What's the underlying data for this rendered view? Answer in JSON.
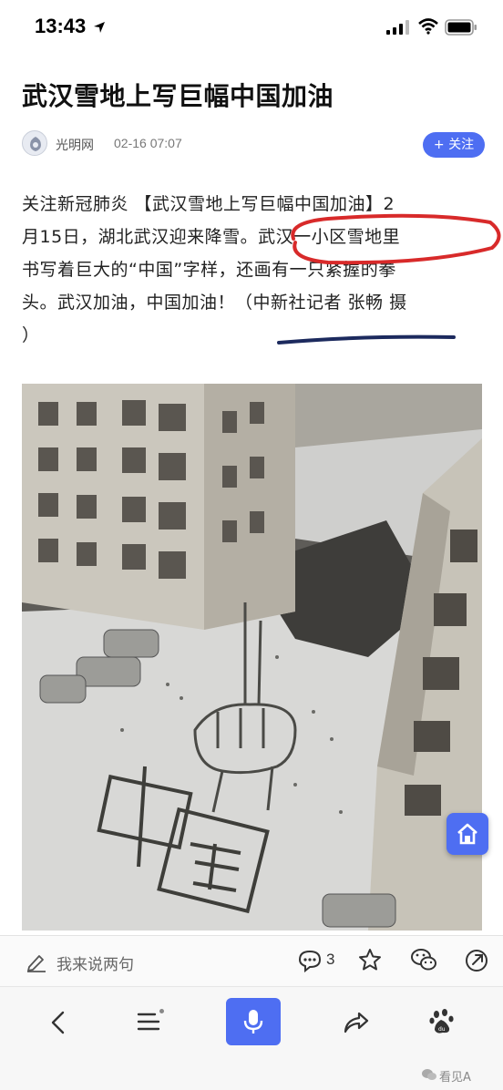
{
  "status_bar": {
    "time": "13:43"
  },
  "article": {
    "title": "武汉雪地上写巨幅中国加油",
    "source": "光明网",
    "date": "02-16 07:07",
    "follow_label": "+ 关注",
    "body_lines": [
      "关注新冠肺炎 【武汉雪地上写巨幅中国加油】2",
      "月15日，湖北武汉迎来降雪。武汉一小区雪地里",
      "书写着巨大的“中国”字样，还画有一只紧握的拳",
      "头。武汉加油，中国加油！（中新社记者 张畅 摄",
      "）"
    ]
  },
  "photo": {
    "alt_chars": "中国"
  },
  "comment_bar": {
    "placeholder": "我来说两句",
    "comment_count": "3"
  },
  "watermark": "看见A",
  "colors": {
    "accent": "#4e6ef2",
    "marker_red": "#d82a2a",
    "marker_navy": "#1c2a5e"
  },
  "icons": [
    "location-arrow-icon",
    "signal-icon",
    "wifi-icon",
    "battery-icon",
    "source-logo-icon",
    "home-icon",
    "pen-icon",
    "comment-icon",
    "star-icon",
    "wechat-icon",
    "share-icon",
    "back-icon",
    "menu-icon",
    "microphone-icon",
    "forward-icon",
    "baidu-paw-icon",
    "wechat-watermark-icon"
  ]
}
